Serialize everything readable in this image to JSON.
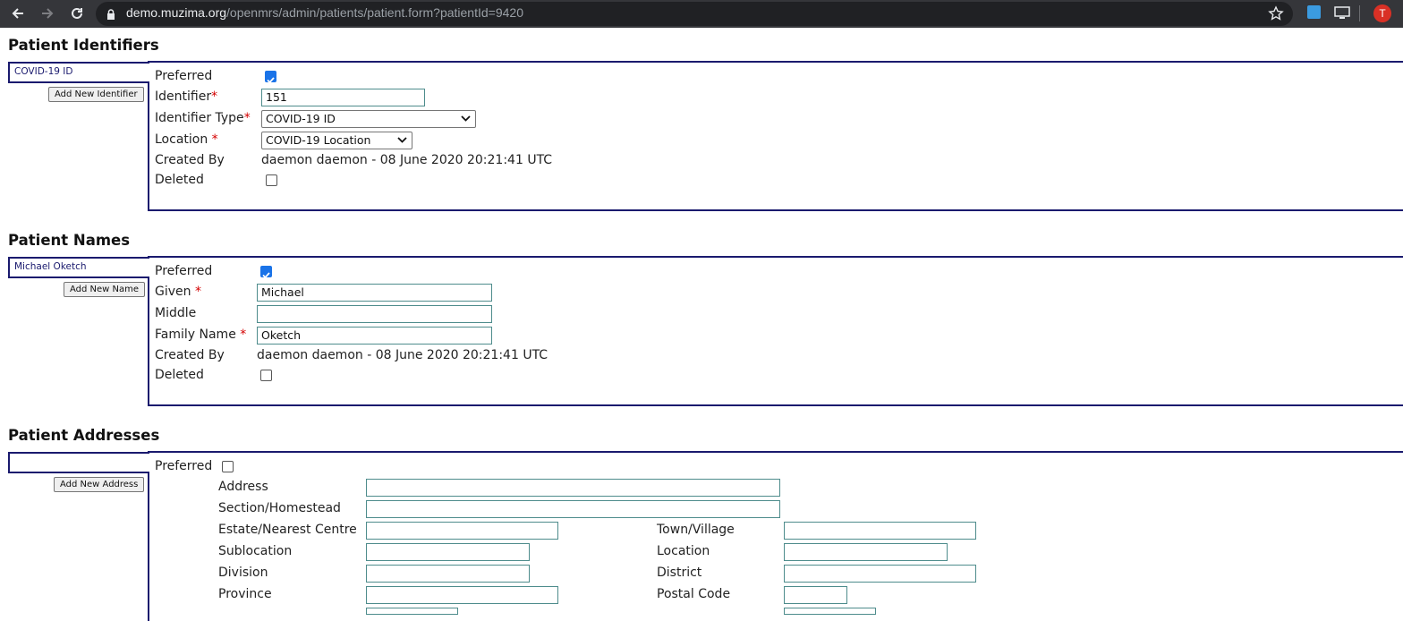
{
  "browser": {
    "url_host": "demo.muzima.org",
    "url_path": "/openmrs/admin/patients/patient.form?patientId=9420",
    "avatar_initial": "T"
  },
  "identifiers": {
    "title": "Patient Identifiers",
    "tab_label": "COVID-19 ID",
    "add_button": "Add New Identifier",
    "preferred_label": "Preferred",
    "preferred_checked": true,
    "identifier_label": "Identifier",
    "identifier_value": "151",
    "type_label": "Identifier Type",
    "type_value": "COVID-19 ID",
    "location_label": "Location",
    "location_value": "COVID-19 Location",
    "created_by_label": "Created By",
    "created_by_value": "daemon daemon - 08 June 2020 20:21:41 UTC",
    "deleted_label": "Deleted",
    "deleted_checked": false
  },
  "names": {
    "title": "Patient Names",
    "tab_label": "Michael Oketch",
    "add_button": "Add New Name",
    "preferred_label": "Preferred",
    "preferred_checked": true,
    "given_label": "Given",
    "given_value": "Michael",
    "middle_label": "Middle",
    "middle_value": "",
    "family_label": "Family Name",
    "family_value": "Oketch",
    "created_by_label": "Created By",
    "created_by_value": "daemon daemon - 08 June 2020 20:21:41 UTC",
    "deleted_label": "Deleted",
    "deleted_checked": false
  },
  "addresses": {
    "title": "Patient Addresses",
    "tab_label": "",
    "add_button": "Add New Address",
    "preferred_label": "Preferred",
    "preferred_checked": false,
    "address_label": "Address",
    "section_label": "Section/Homestead",
    "estate_label": "Estate/Nearest Centre",
    "town_label": "Town/Village",
    "sublocation_label": "Sublocation",
    "location_label": "Location",
    "division_label": "Division",
    "district_label": "District",
    "province_label": "Province",
    "postal_label": "Postal Code"
  },
  "colors": {
    "chrome": "#35363a",
    "panel_border": "#1a1a6e",
    "required": "#d40000",
    "checkbox_on": "#1a73e8",
    "input_border": "#4e8c8c"
  }
}
